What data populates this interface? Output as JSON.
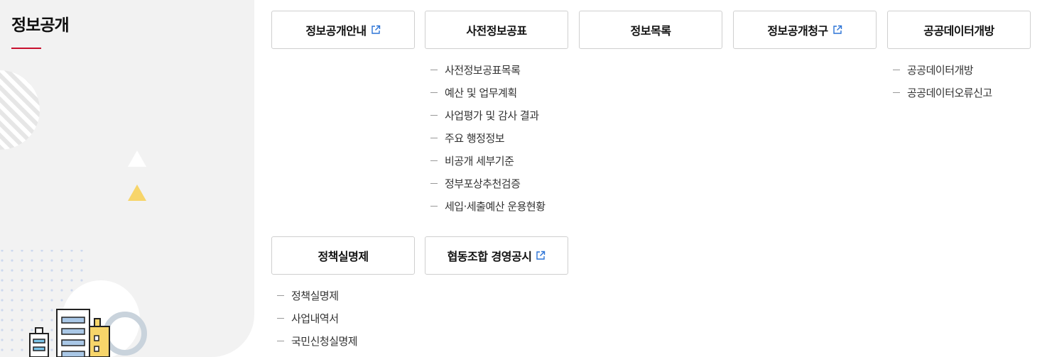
{
  "sidebar": {
    "title": "정보공개"
  },
  "menu": {
    "row1": [
      {
        "label": "정보공개안내",
        "external": true
      },
      {
        "label": "사전정보공표",
        "external": false
      },
      {
        "label": "정보목록",
        "external": false
      },
      {
        "label": "정보공개청구",
        "external": true
      },
      {
        "label": "공공데이터개방",
        "external": false
      }
    ],
    "row2": [
      {
        "label": "정책실명제",
        "external": false
      },
      {
        "label": "협동조합 경영공시",
        "external": true
      }
    ],
    "pre_disclosure_items": [
      "사전정보공표목록",
      "예산 및 업무계획",
      "사업평가 및 감사 결과",
      "주요 행정정보",
      "비공개 세부기준",
      "정부포상추천검증",
      "세입·세출예산 운용현황"
    ],
    "open_data_items": [
      "공공데이터개방",
      "공공데이터오류신고"
    ],
    "policy_items": [
      "정책실명제",
      "사업내역서",
      "국민신청실명제"
    ]
  },
  "colors": {
    "accent": "#c8102e",
    "sidebar_bg": "#f2f2f2",
    "external_icon": "#2b73d6"
  },
  "icons": {
    "external": "external-link-icon",
    "dash": "dash-icon"
  }
}
